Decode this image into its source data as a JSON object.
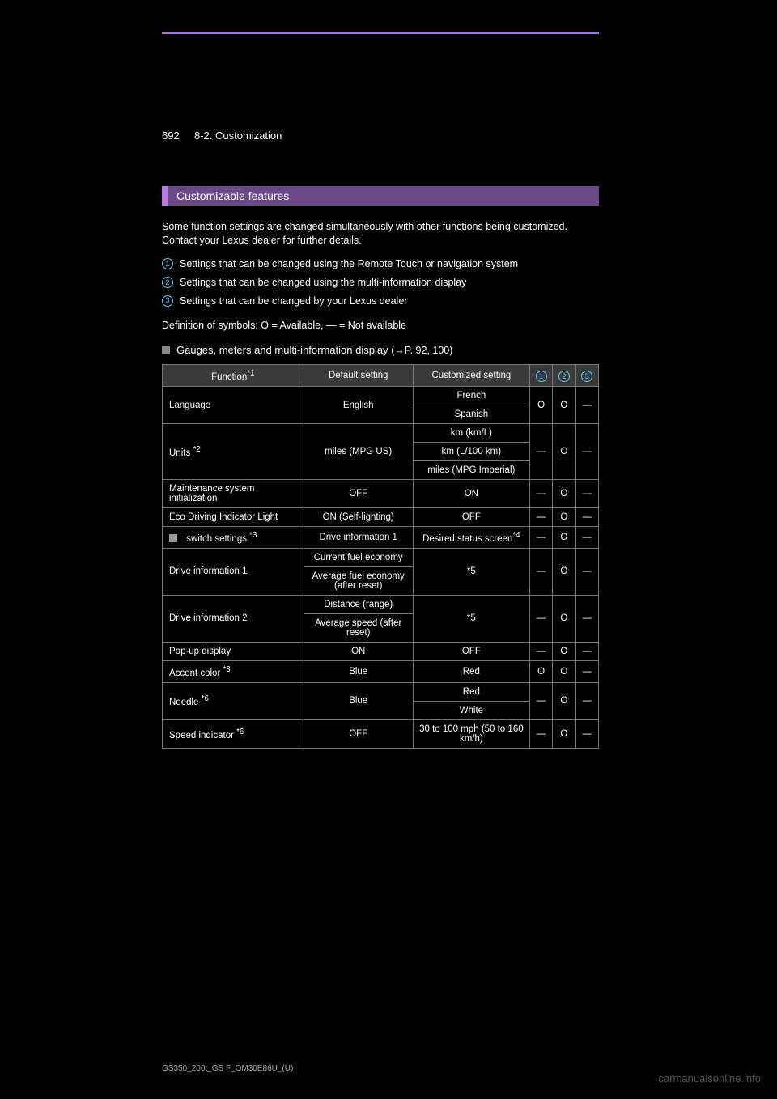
{
  "header": {
    "page_number": "692",
    "breadcrumb": "8-2. Customization"
  },
  "section": {
    "title": "Customizable features"
  },
  "intro": "Some function settings are changed simultaneously with other functions being customized. Contact your Lexus dealer for further details.",
  "legend": {
    "items": [
      "Settings that can be changed using the Remote Touch or navigation system",
      "Settings that can be changed using the multi-information display",
      "Settings that can be changed by your Lexus dealer"
    ],
    "footnote": "Definition of symbols: O = Available, — = Not available"
  },
  "subsection": {
    "title": "Gauges, meters and multi-information display",
    "pageref_label": "P. 92, 100"
  },
  "table": {
    "headers": {
      "function": "Function",
      "function_note": "*1",
      "default": "Default setting",
      "custom": "Customized setting"
    },
    "col_marks": [
      "1",
      "2",
      "3"
    ],
    "rows": [
      {
        "function": "Language",
        "note": "",
        "default": "English",
        "custom": [
          "French",
          "Spanish"
        ],
        "cols": [
          "O",
          "O",
          "—"
        ]
      },
      {
        "function": "Units",
        "note": "*2",
        "default": "miles (MPG US)",
        "custom": [
          "km (km/L)",
          "km (L/100 km)",
          "miles (MPG Imperial)"
        ],
        "cols": [
          "—",
          "O",
          "—"
        ]
      },
      {
        "function": "Maintenance system initialization",
        "note": "",
        "default": "OFF",
        "custom": [
          "ON"
        ],
        "cols": [
          "—",
          "O",
          "—"
        ]
      },
      {
        "function": "Eco Driving Indicator Light",
        "note": "",
        "default": "ON (Self-lighting)",
        "custom": [
          "OFF"
        ],
        "cols": [
          "—",
          "O",
          "—"
        ]
      },
      {
        "function": "switch settings",
        "note": "*3",
        "icon": true,
        "default": "Drive information 1",
        "custom_html": "Desired status screen<span class='sup'>*4</span>",
        "cols": [
          "—",
          "O",
          "—"
        ]
      },
      {
        "function": "Drive information 1",
        "note": "",
        "default_multi": [
          "Current fuel economy",
          "Average fuel economy (after reset)"
        ],
        "custom": [
          "*5"
        ],
        "cols": [
          "—",
          "O",
          "—"
        ]
      },
      {
        "function": "Drive information 2",
        "note": "",
        "default_multi": [
          "Distance (range)",
          "Average speed (after reset)"
        ],
        "custom": [
          "*5"
        ],
        "cols": [
          "—",
          "O",
          "—"
        ]
      },
      {
        "function": "Pop-up display",
        "note": "",
        "default": "ON",
        "custom": [
          "OFF"
        ],
        "cols": [
          "—",
          "O",
          "—"
        ]
      },
      {
        "function": "Accent color",
        "note": "*3",
        "default": "Blue",
        "custom": [
          "Red"
        ],
        "cols": [
          "O",
          "O",
          "—"
        ]
      },
      {
        "function": "Needle",
        "note": "*6",
        "default": "Blue",
        "custom": [
          "Red",
          "White"
        ],
        "cols": [
          "—",
          "O",
          "—"
        ]
      },
      {
        "function": "Speed indicator",
        "note": "*6",
        "default": "OFF",
        "custom": [
          "30 to 100 mph (50 to 160 km/h)"
        ],
        "cols": [
          "—",
          "O",
          "—"
        ]
      }
    ]
  },
  "footer": {
    "model_code": "GS350_200t_GS F_OM30E86U_(U)",
    "watermark": "carmanualsonline.info"
  }
}
